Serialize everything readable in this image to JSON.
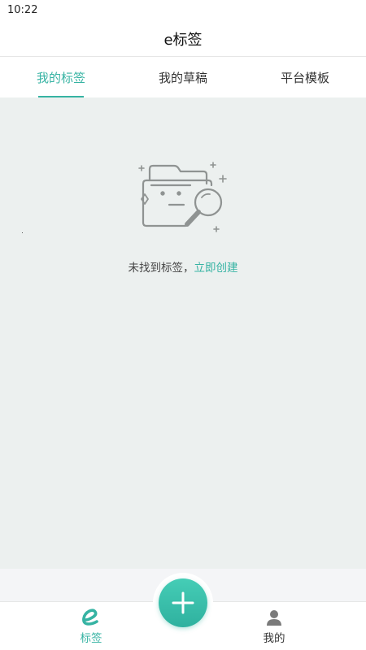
{
  "status_bar": {
    "time": "10:22"
  },
  "header": {
    "title": "e标签"
  },
  "tabs": [
    {
      "label": "我的标签",
      "active": true
    },
    {
      "label": "我的草稿",
      "active": false
    },
    {
      "label": "平台模板",
      "active": false
    }
  ],
  "empty_state": {
    "message": "未找到标签，",
    "action_label": "立即创建",
    "illustration_icon": "folder-magnifier-icon"
  },
  "bottom_nav": {
    "items": [
      {
        "label": "标签",
        "icon": "e-logo-icon",
        "active": true
      },
      {
        "label": "我的",
        "icon": "person-icon",
        "active": false
      }
    ],
    "fab_icon": "plus-icon"
  },
  "colors": {
    "accent": "#36b3a3",
    "content_background": "#ecf0ef",
    "fab_gradient_top": "#45cdb6",
    "fab_gradient_bottom": "#2fb19f"
  }
}
